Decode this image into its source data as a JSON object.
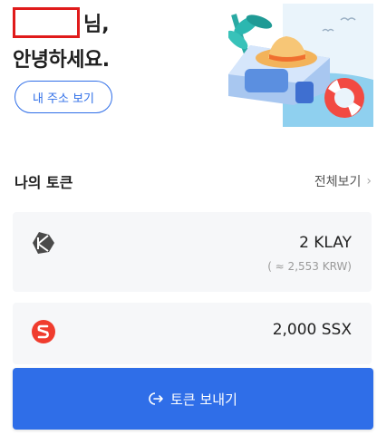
{
  "greeting": {
    "name_suffix": "님,",
    "hello": "안녕하세요.",
    "address_button": "내 주소 보기"
  },
  "tokens_section": {
    "title": "나의 토큰",
    "view_all": "전체보기",
    "chevron": "›"
  },
  "tokens": [
    {
      "icon": "klay-icon",
      "amount": "2 KLAY",
      "fiat": "( ≈ 2,553 KRW)"
    },
    {
      "icon": "ssx-icon",
      "amount": "2,000 SSX"
    }
  ],
  "send_button": {
    "icon": "send-arrow-icon",
    "label": "토큰 보내기"
  },
  "colors": {
    "accent": "#2f6ee8",
    "card_bg": "#f6f7f9",
    "redaction": "#e01b1b",
    "ssx_red": "#f03c2e",
    "klay_dark": "#4a4a4a"
  }
}
